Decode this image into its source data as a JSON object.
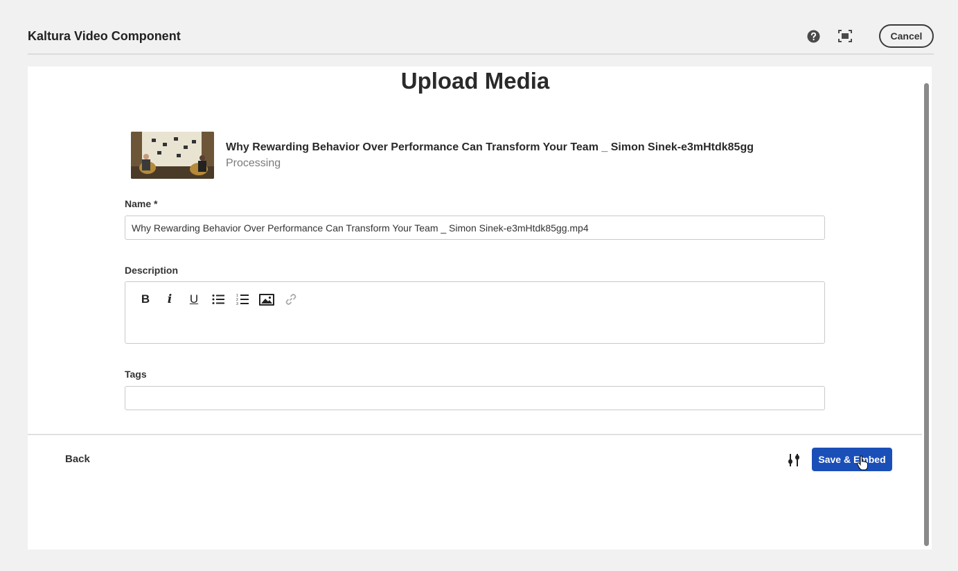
{
  "header": {
    "title": "Kaltura Video Component",
    "cancel_label": "Cancel",
    "help_icon": "help-icon",
    "fullscreen_icon": "fullscreen-icon"
  },
  "dialog": {
    "title": "Upload Media",
    "media": {
      "name": "Why Rewarding Behavior Over Performance Can Transform Your Team _ Simon Sinek-e3mHtdk85gg",
      "status": "Processing"
    },
    "fields": {
      "name_label": "Name *",
      "name_value": "Why Rewarding Behavior Over Performance Can Transform Your Team _ Simon Sinek-e3mHtdk85gg.mp4",
      "description_label": "Description",
      "tags_label": "Tags",
      "tags_value": ""
    },
    "toolbar": {
      "bold": "B",
      "italic": "i",
      "underline": "U"
    },
    "footer": {
      "back_label": "Back",
      "save_label": "Save & Embed"
    }
  },
  "colors": {
    "primary": "#1a4fb8",
    "background": "#f1f1f1"
  }
}
